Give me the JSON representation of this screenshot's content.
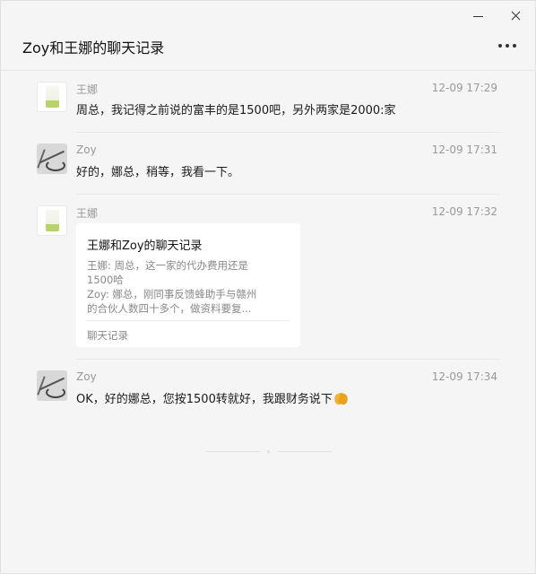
{
  "window": {
    "title": "Zoy和王娜的聊天记录"
  },
  "messages": [
    {
      "sender": "王娜",
      "time": "12-09 17:29",
      "text": "周总，我记得之前说的富丰的是1500吧，另外两家是2000:家"
    },
    {
      "sender": "Zoy",
      "time": "12-09 17:31",
      "text": "好的，娜总，稍等，我看一下。"
    },
    {
      "sender": "王娜",
      "time": "12-09 17:32",
      "card": {
        "title": "王娜和Zoy的聊天记录",
        "lines": [
          "王娜: 周总，这一家的代办费用还是",
          "1500哈",
          "Zoy: 娜总，刚同事反馈蜂助手与赣州",
          "的合伙人数四十多个，做资料要复..."
        ],
        "footer": "聊天记录"
      }
    },
    {
      "sender": "Zoy",
      "time": "12-09 17:34",
      "text": "OK，好的娜总，您按1500转就好，我跟财务说下",
      "emoji": "folded-hands-emoji"
    }
  ]
}
